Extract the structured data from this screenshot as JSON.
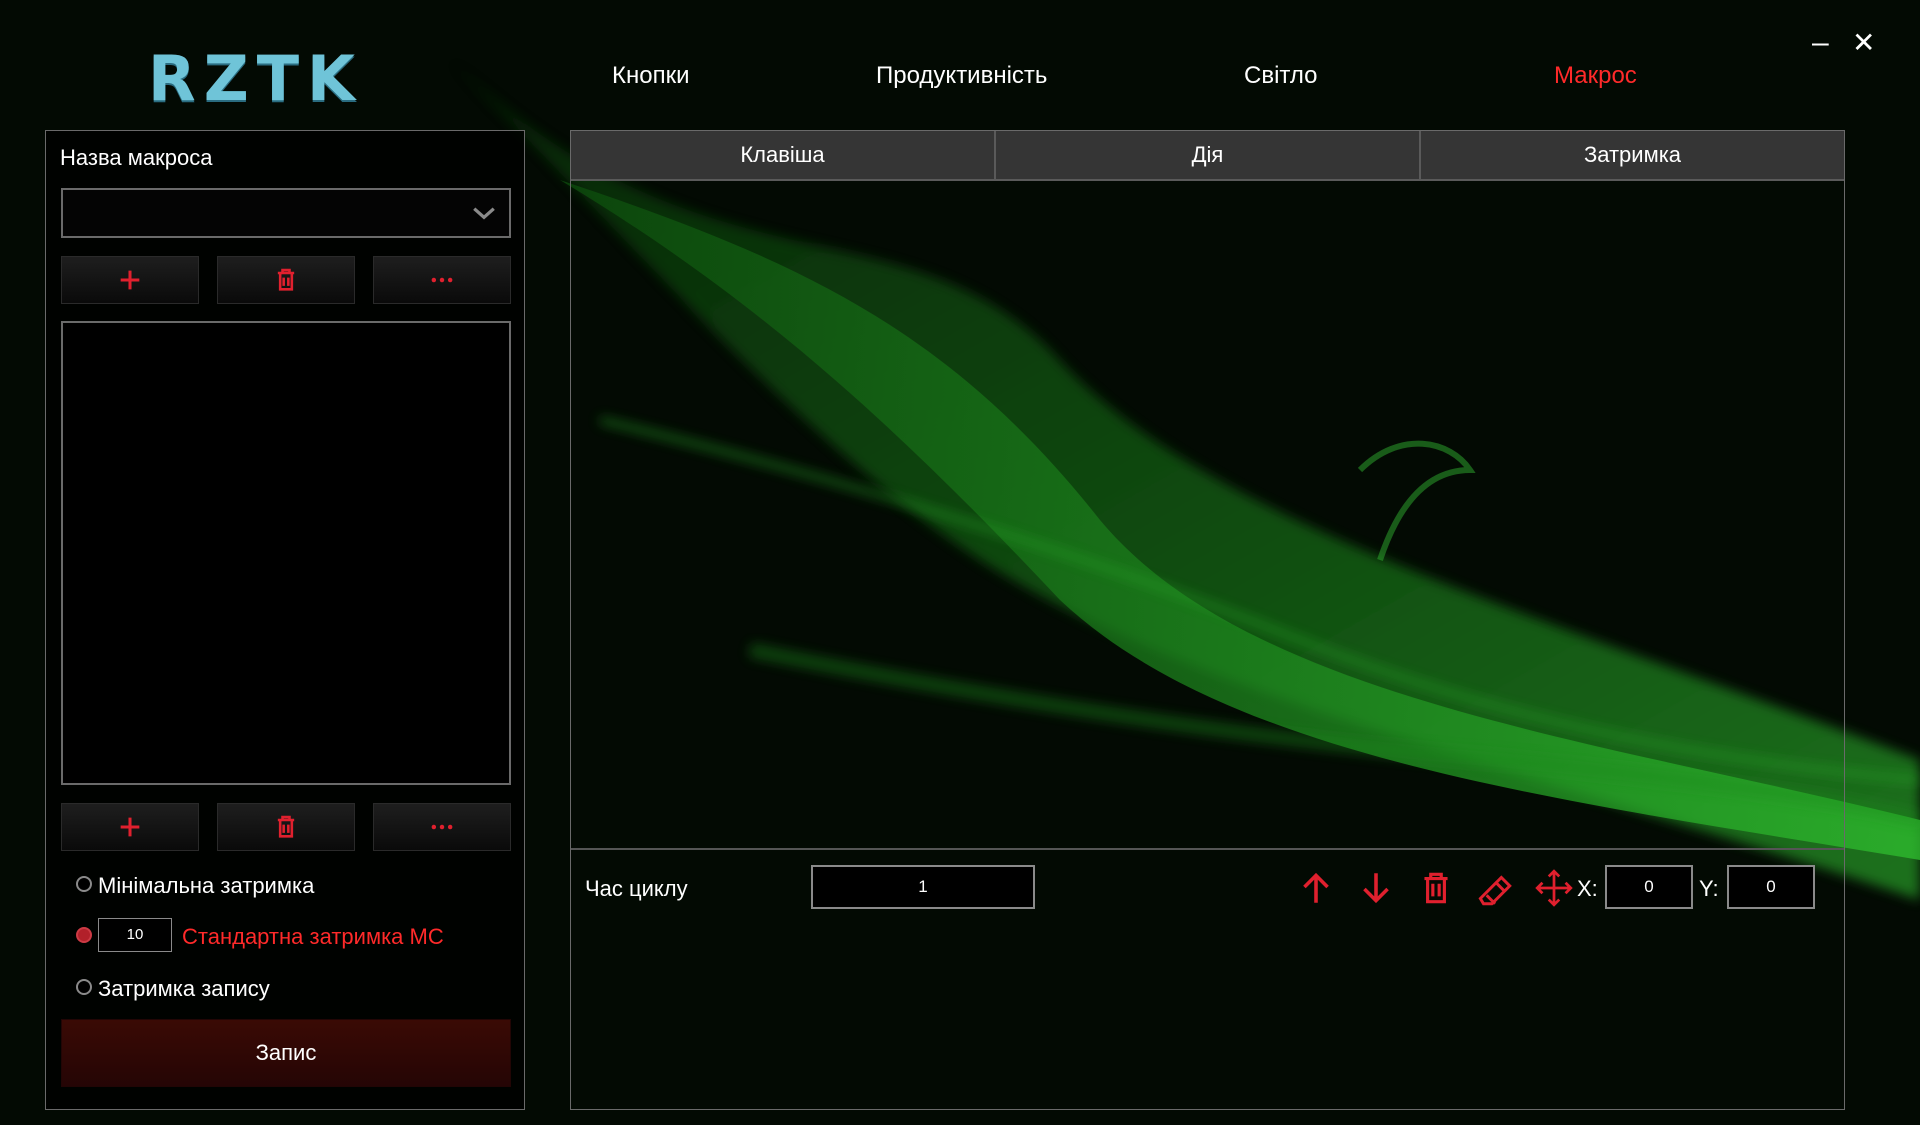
{
  "app": {
    "logo": "RZTK"
  },
  "window_controls": {
    "minimize": "–",
    "close": "✕"
  },
  "nav": {
    "tabs": [
      {
        "label": "Кнопки",
        "active": false
      },
      {
        "label": "Продуктивність",
        "active": false
      },
      {
        "label": "Світло",
        "active": false
      },
      {
        "label": "Макрос",
        "active": true
      }
    ]
  },
  "left": {
    "macro_name_label": "Назва макроса",
    "macro_select_value": "",
    "top_buttons": [
      "plus-icon",
      "trash-icon",
      "more-icon"
    ],
    "bottom_buttons": [
      "plus-icon",
      "trash-icon",
      "more-icon"
    ],
    "delay_options": [
      {
        "label": "Мінімальна затримка",
        "selected": false
      },
      {
        "label": "Стандартна затримка МС",
        "selected": true,
        "value": "10"
      },
      {
        "label": "Затримка запису",
        "selected": false
      }
    ],
    "record_label": "Запис"
  },
  "table": {
    "columns": [
      "Клавіша",
      "Дія",
      "Затримка"
    ],
    "rows": []
  },
  "footer": {
    "cycle_label": "Час циклу",
    "cycle_value": "1",
    "tools": [
      "arrow-up-icon",
      "arrow-down-icon",
      "trash-icon",
      "eraser-icon",
      "move-icon"
    ],
    "x_label": "X:",
    "x_value": "0",
    "y_label": "Y:",
    "y_value": "0"
  },
  "colors": {
    "accent": "#ff2a2a",
    "icon_red": "#e0202e",
    "logo": "#6fc4d8",
    "background": "#030a03",
    "wave_green": "#1fa01f"
  }
}
